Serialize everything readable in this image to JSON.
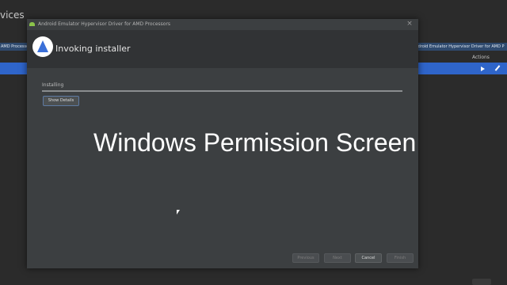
{
  "background": {
    "title": "vices",
    "tab_left": "AMD Processors",
    "tab_right": "Android Emulator Hypervisor Driver for AMD P",
    "actions_header": "Actions",
    "play_icon": "play-icon",
    "edit_icon": "pencil-icon"
  },
  "dialog": {
    "window_title": "Android Emulator Hypervisor Driver for AMD Processors",
    "close_glyph": "×",
    "header_title": "Invoking installer",
    "status_label": "Installing",
    "progress": 1.0,
    "show_details_label": "Show Details",
    "overlay_text": "Windows Permission Screen",
    "buttons": {
      "previous": "Previous",
      "next": "Next",
      "cancel": "Cancel",
      "finish": "Finish"
    }
  },
  "colors": {
    "selection_blue": "#2f65ca",
    "dialog_bg": "#3c3f41",
    "header_bg": "#313335"
  }
}
